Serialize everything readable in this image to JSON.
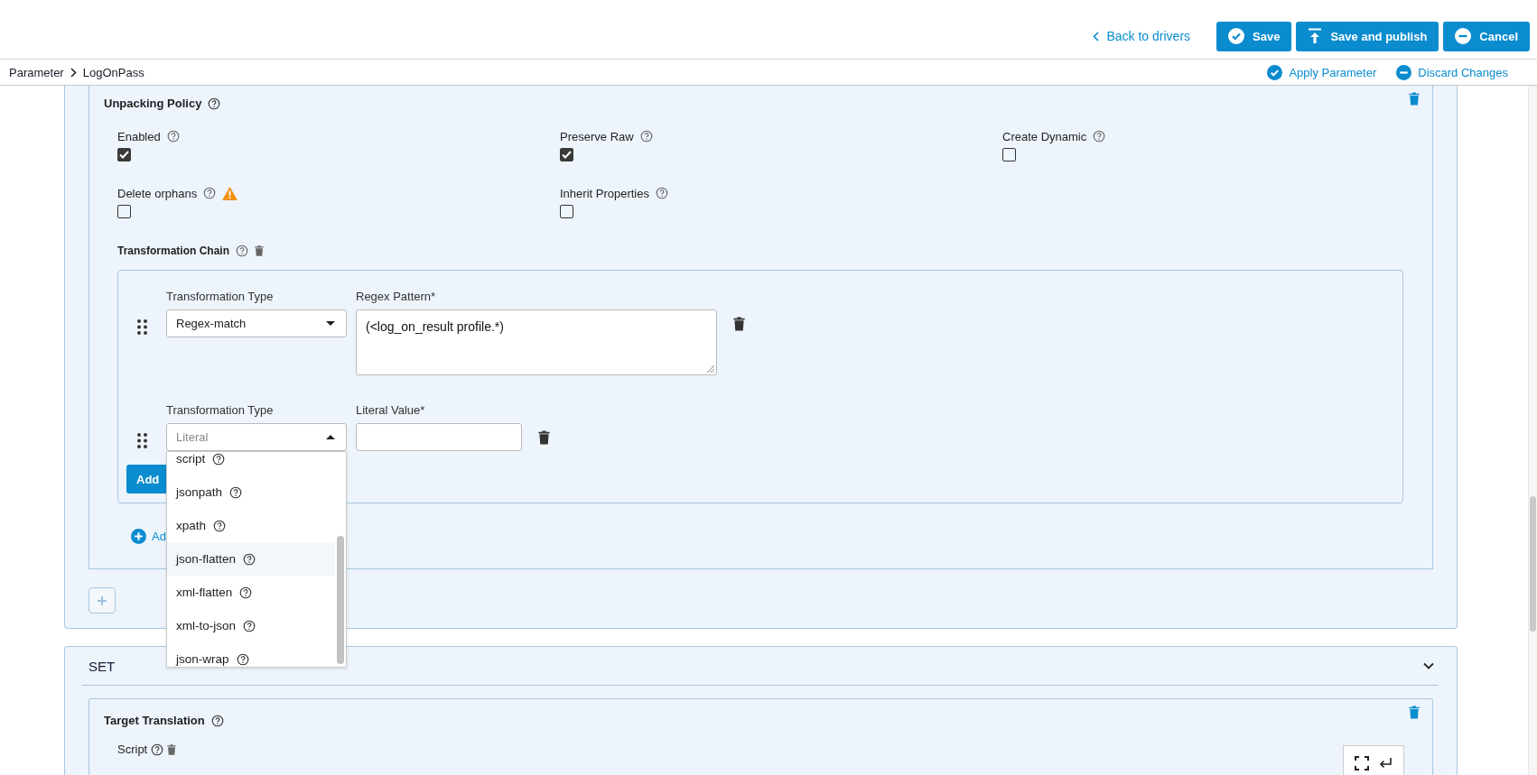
{
  "header": {
    "back_link": "Back to drivers",
    "buttons": [
      {
        "label": "Save"
      },
      {
        "label": "Save and publish"
      },
      {
        "label": "Cancel"
      }
    ]
  },
  "breadcrumb": [
    "Parameter",
    "LogOnPass"
  ],
  "breadcrumb_actions": [
    {
      "label": "Apply Parameter"
    },
    {
      "label": "Discard Changes"
    }
  ],
  "unpacking_policy": {
    "title": "Unpacking Policy",
    "options": [
      {
        "label": "Enabled",
        "checked": true,
        "warning": false
      },
      {
        "label": "Preserve Raw",
        "checked": true,
        "warning": false
      },
      {
        "label": "Create Dynamic",
        "checked": false,
        "warning": false
      },
      {
        "label": "Delete orphans",
        "checked": false,
        "warning": true
      },
      {
        "label": "Inherit Properties",
        "checked": false,
        "warning": false
      }
    ],
    "transformation_chain": {
      "title": "Transformation Chain",
      "steps": [
        {
          "type_label": "Transformation Type",
          "type_value": "Regex-match",
          "value_label": "Regex Pattern*",
          "kind": "textarea",
          "value": "(<log_on_result profile.*)",
          "open": false
        },
        {
          "type_label": "Transformation Type",
          "type_value": "Literal",
          "value_label": "Literal Value*",
          "kind": "input",
          "open": true,
          "options": [
            {
              "label": "script",
              "highlighted": false
            },
            {
              "label": "jsonpath",
              "highlighted": false
            },
            {
              "label": "xpath",
              "highlighted": false
            },
            {
              "label": "json-flatten",
              "highlighted": true
            },
            {
              "label": "xml-flatten",
              "highlighted": false
            },
            {
              "label": "xml-to-json",
              "highlighted": false
            },
            {
              "label": "json-wrap",
              "highlighted": false
            }
          ]
        }
      ],
      "add_step_button": "Add"
    },
    "add_link": "Ad"
  },
  "set_section": {
    "title": "SET",
    "expanded": true,
    "target_translation": {
      "title": "Target Translation",
      "script_label": "Script"
    }
  }
}
